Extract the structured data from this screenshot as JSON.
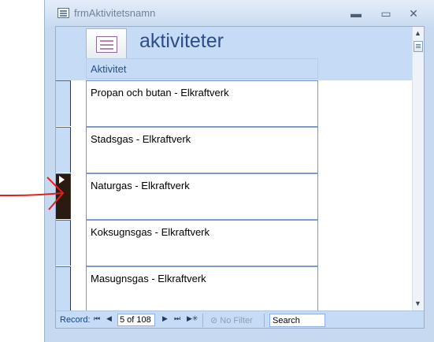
{
  "window": {
    "title": "frmAktivitetsnamn",
    "minimize": "▬",
    "restore": "▭",
    "close": "✕"
  },
  "header": {
    "form_title": "aktiviteter",
    "column_label": "Aktivitet"
  },
  "records": [
    {
      "value": "Propan och butan - Elkraftverk",
      "current": false
    },
    {
      "value": "Stadsgas - Elkraftverk",
      "current": false
    },
    {
      "value": "Naturgas - Elkraftverk",
      "current": true
    },
    {
      "value": "Koksugnsgas - Elkraftverk",
      "current": false
    },
    {
      "value": "Masugnsgas - Elkraftverk",
      "current": false
    }
  ],
  "navigation": {
    "label": "Record:",
    "first": "⏮",
    "prev": "◀",
    "position": "5 of 108",
    "next": "▶",
    "last": "⏭",
    "new": "▶✳",
    "filter_label": "No Filter",
    "search_placeholder": "Search"
  },
  "colors": {
    "accent": "#c6dbf5",
    "annotation_arrow": "#e02020",
    "current_selector": "#2b1a10"
  }
}
